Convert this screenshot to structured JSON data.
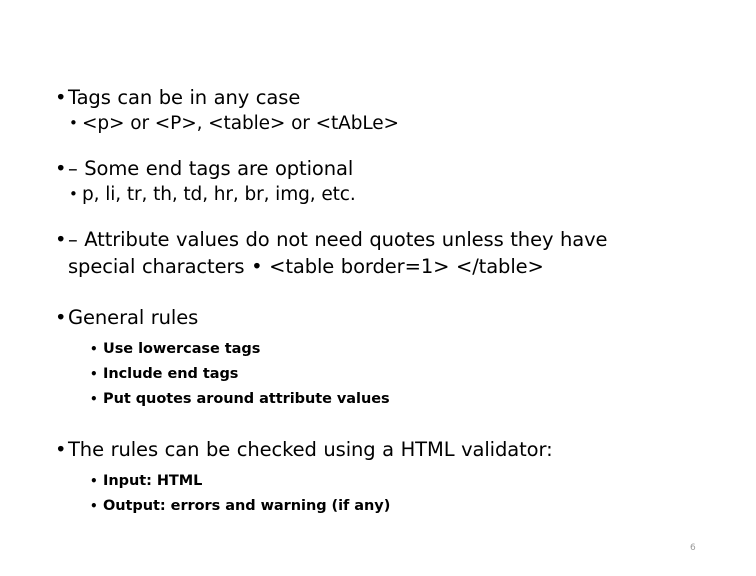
{
  "slide": {
    "page_number": "6",
    "background_color": "#ffffff",
    "text_color": "#000000",
    "page_number_color": "#9a9a9a",
    "blocks": [
      {
        "id": "tags-case",
        "level1": "Tags can be in any case",
        "level2": "<p> or <P>, <table> or <tAbLe>"
      },
      {
        "id": "end-tags",
        "level1": "– Some end tags are optional",
        "level2": "p, li, tr, th, td, hr, br, img, etc."
      },
      {
        "id": "attribute-quotes",
        "level1": "– Attribute values do not need quotes unless they have special characters • <table border=1> </table>"
      },
      {
        "id": "general-rules",
        "level1": "General rules",
        "level3": [
          "Use lowercase tags",
          "Include end tags",
          "Put quotes around attribute values"
        ]
      },
      {
        "id": "validator",
        "level1": "The rules can be checked using a HTML validator:",
        "level3": [
          "Input: HTML",
          "Output: errors and warning (if any)"
        ]
      }
    ]
  },
  "bullets": {
    "level1_glyph": "•",
    "level2_glyph": "•",
    "level3_glyph": "•"
  }
}
